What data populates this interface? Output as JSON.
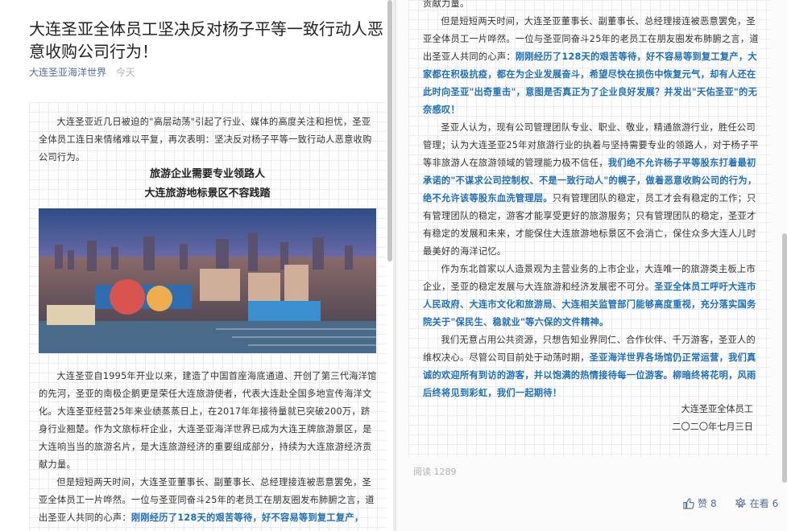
{
  "article": {
    "title": "大连圣亚全体员工坚决反对杨子平等一致行动人恶意收购公司行为！",
    "account": "大连圣亚海洋世界",
    "date": "今天"
  },
  "left": {
    "p1": "大连圣亚近几日被迫的\"高层动荡\"引起了行业、媒体的高度关注和担忧，圣亚全体员工连日来情绪难以平复，再次表明：坚决反对杨子平等一致行动人恶意收购公司行为。",
    "heading1": "旅游企业需要专业领路人",
    "heading2": "大连旅游地标景区不容践踏",
    "p2": "大连圣亚自1995年开业以来，建造了中国首座海底通道、开创了第三代海洋馆的先河，圣亚的南极企鹅更是荣任大连旅游使者，代表大连赴全国多地宣传海洋文化。大连圣亚经营25年来业绩蒸蒸日上，在2017年年接待量就已突破200万，跻身行业翘楚。作为文旅标杆企业，大连圣亚海洋世界已成为大连王牌旅游景区，是大连响当当的旅游名片，是大连旅游经济的重要组成部分，持续为大连旅游经济贡献力量。",
    "p3a": "但是短短两天时间，大连圣亚董事长、副董事长、总经理接连被恶意罢免，圣亚全体员工一片哗然。一位与圣亚同奋斗25年的老员工在朋友圈发布肺腑之言，道出圣亚人共同的心声：",
    "p3b": "刚刚经历了128天的艰苦等待，好不容易等到复工复产，"
  },
  "right": {
    "top_line": "贡献力量。",
    "p1a": "但是短短两天时间，大连圣亚董事长、副董事长、总经理接连被恶意罢免，圣亚全体员工一片哗然。一位与圣亚同奋斗25年的老员工在朋友圈发布肺腑之言，道出圣亚人共同的心声：",
    "p1b": "刚刚经历了128天的艰苦等待，好不容易等到复工复产，大家都在积极抗疫，都在为企业发展奋斗，希望尽快在损伤中恢复元气，却有人还在此时向圣亚\"出奇重击\"，意图是否真正为了企业良好发展？并发出\"天佑圣亚\"的无奈感叹！",
    "p2a": "圣亚人认为，现有公司管理团队专业、职业、敬业，精通旅游行业，胜任公司管理；认为大连圣亚25年对旅游行业的执着与坚持需要专业的领路人，对于杨子平等非旅游人在旅游领域的管理能力极不信任，",
    "p2b": "我们绝不允许杨子平等股东打着最初承诺的\"不谋求公司控制权、不是一致行动人\"的幌子，做着恶意收购公司的行为，绝不允许该等股东血洗管理层。",
    "p2c": "只有管理团队的稳定，员工才会有稳定的工作；只有管理团队的稳定，游客才能享受更好的旅游服务；只有管理团队的稳定，圣亚才有稳定的发展和未来，才能保住大连旅游地标景区不会消亡，保住众多大连人儿时最美好的海洋记忆。",
    "p3a": "作为东北首家以人造景观为主营业务的上市企业，大连唯一的旅游类主板上市企业，圣亚的稳定发展与大连旅游和经济发展密不可分。",
    "p3b": "圣亚全体员工呼吁大连市人民政府、大连市文化和旅游局、大连相关监管部门能够高度重视，充分落实国务院关于\"保民生、稳就业\"等六保的文件精神。",
    "p4a": "我们无意占用公共资源，只想告知业界同仁、合作伙伴、千万游客，圣亚人的维权决心。尽管公司目前处于动荡时期，",
    "p4b": "圣亚海洋世界各场馆仍正常运营，我们真诚的欢迎所有到访的游客，并以饱满的热情接待每一位游客。柳暗终将花明，风雨后终将见到彩虹，我们一起期待！",
    "sign1": "大连圣亚全体员工",
    "sign2": "二〇二〇年七月三日"
  },
  "footer": {
    "reads_label": "阅读",
    "reads_count": "1289",
    "like_label": "赞",
    "like_count": "8",
    "watch_label": "在看",
    "watch_count": "6"
  },
  "colors": {
    "highlight": "#1e6fb7",
    "link": "#576b95",
    "muted": "#b2b2b2"
  }
}
